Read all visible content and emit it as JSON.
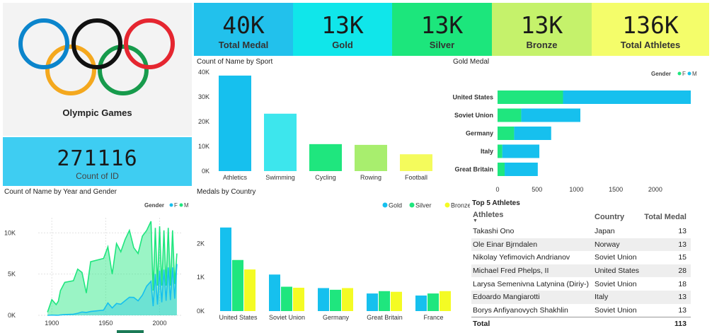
{
  "logo": {
    "title": "Olympic Games",
    "ring_colors": [
      "#0b85cc",
      "#111111",
      "#e52630",
      "#f4a81e",
      "#179b4c"
    ]
  },
  "count_card": {
    "value": "271116",
    "label": "Count of ID"
  },
  "kpis": [
    {
      "value": "40K",
      "label": "Total Medal",
      "bg": "#22c1ec"
    },
    {
      "value": "13K",
      "label": "Gold",
      "bg": "#10e6ea"
    },
    {
      "value": "13K",
      "label": "Silver",
      "bg": "#1ce67c"
    },
    {
      "value": "13K",
      "label": "Bronze",
      "bg": "#c5f26b"
    },
    {
      "value": "136K",
      "label": "Total Athletes",
      "bg": "#f4fd6a"
    }
  ],
  "charts": {
    "sport": {
      "title": "Count of Name by Sport"
    },
    "gold": {
      "title": "Gold Medal",
      "legend_title": "Gender",
      "legend": [
        "F",
        "M"
      ]
    },
    "year": {
      "title": "Count of Name by Year and Gender",
      "legend_title": "Gender",
      "legend": [
        "F",
        "M"
      ]
    },
    "country": {
      "title": "Medals by Country",
      "legend": [
        "Gold",
        "Silver",
        "Bronze"
      ]
    }
  },
  "chart_data": [
    {
      "type": "bar",
      "title": "Count of Name by Sport",
      "categories": [
        "Athletics",
        "Swimming",
        "Cycling",
        "Rowing",
        "Football"
      ],
      "values": [
        38600,
        23200,
        10900,
        10600,
        6800
      ],
      "colors": [
        "#16c0ee",
        "#3de6ed",
        "#1fe67e",
        "#a8ee6e",
        "#f4fb5c"
      ],
      "yticks": [
        "0K",
        "10K",
        "20K",
        "30K",
        "40K"
      ],
      "ylim": [
        0,
        40000
      ]
    },
    {
      "type": "bar",
      "orientation": "horizontal",
      "stacked": true,
      "title": "Gold Medal",
      "categories": [
        "United States",
        "Soviet Union",
        "Germany",
        "Italy",
        "Great Britain"
      ],
      "series": [
        {
          "name": "F",
          "values": [
            830,
            300,
            210,
            60,
            90
          ],
          "color": "#1fe67e"
        },
        {
          "name": "M",
          "values": [
            1620,
            750,
            470,
            470,
            420
          ],
          "color": "#16c0ee"
        }
      ],
      "xticks": [
        "0",
        "500",
        "1000",
        "1500",
        "2000"
      ],
      "xlim": [
        0,
        2450
      ]
    },
    {
      "type": "area",
      "title": "Count of Name by Year and Gender",
      "x": [
        1896,
        1900,
        1904,
        1906,
        1908,
        1912,
        1920,
        1924,
        1928,
        1932,
        1936,
        1948,
        1952,
        1956,
        1960,
        1964,
        1968,
        1972,
        1976,
        1980,
        1984,
        1988,
        1992,
        1994,
        1996,
        1998,
        2000,
        2002,
        2004,
        2006,
        2008,
        2010,
        2012,
        2014,
        2016
      ],
      "series": [
        {
          "name": "M",
          "color": "#1fe67e",
          "values": [
            380,
            1900,
            1300,
            1700,
            3000,
            4000,
            4200,
            5600,
            5200,
            2700,
            6500,
            6900,
            8300,
            5000,
            8700,
            7700,
            9200,
            10300,
            8200,
            7500,
            9600,
            10300,
            11400,
            3000,
            10600,
            3600,
            10800,
            3600,
            10300,
            3600,
            10600,
            3600,
            10300,
            3800,
            7500
          ]
        },
        {
          "name": "F",
          "color": "#16c0ee",
          "values": [
            0,
            33,
            16,
            11,
            47,
            87,
            134,
            244,
            404,
            347,
            468,
            628,
            1497,
            893,
            1435,
            1348,
            1777,
            2193,
            2172,
            1756,
            2447,
            3543,
            4124,
            1105,
            5008,
            1314,
            5431,
            1582,
            5546,
            1757,
            5816,
            1847,
            5815,
            2023,
            6223
          ]
        }
      ],
      "xticks": [
        "1900",
        "1950",
        "2000"
      ],
      "yticks": [
        "0K",
        "5K",
        "10K"
      ],
      "ylim": [
        0,
        12000
      ]
    },
    {
      "type": "bar",
      "title": "Medals by Country",
      "categories": [
        "United States",
        "Soviet Union",
        "Germany",
        "Great Britain",
        "France"
      ],
      "series": [
        {
          "name": "Gold",
          "values": [
            2470,
            1080,
            680,
            520,
            460
          ],
          "color": "#16c0ee"
        },
        {
          "name": "Silver",
          "values": [
            1510,
            720,
            630,
            590,
            520
          ],
          "color": "#1fe67e"
        },
        {
          "name": "Bronze",
          "values": [
            1230,
            690,
            680,
            570,
            590
          ],
          "color": "#f4fb24"
        }
      ],
      "yticks": [
        "0K",
        "1K",
        "2K"
      ],
      "ylim": [
        0,
        2800
      ]
    }
  ],
  "top5": {
    "title": "Top 5 Athletes",
    "headers": [
      "Athletes",
      "Country",
      "Total Medal"
    ],
    "rows": [
      {
        "athlete": "Takashi Ono",
        "country": "Japan",
        "total": "13"
      },
      {
        "athlete": "Ole Einar Bjrndalen",
        "country": "Norway",
        "total": "13"
      },
      {
        "athlete": "Nikolay Yefimovich Andrianov",
        "country": "Soviet Union",
        "total": "15"
      },
      {
        "athlete": "Michael Fred Phelps, II",
        "country": "United States",
        "total": "28"
      },
      {
        "athlete": "Larysa Semenivna Latynina (Diriy-)",
        "country": "Soviet Union",
        "total": "18"
      },
      {
        "athlete": "Edoardo Mangiarotti",
        "country": "Italy",
        "total": "13"
      },
      {
        "athlete": "Borys Anfiyanovych Shakhlin",
        "country": "Soviet Union",
        "total": "13"
      }
    ],
    "total_label": "Total",
    "total_value": "113"
  }
}
